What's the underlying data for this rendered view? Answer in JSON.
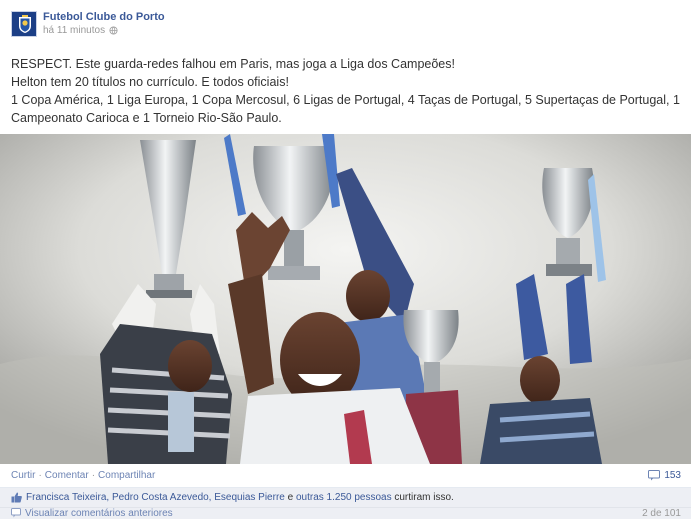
{
  "post": {
    "page_name": "Futebol Clube do Porto",
    "time": "há 11 minutos",
    "text_lines": [
      "RESPECT. Este guarda-redes falhou em Paris, mas joga a Liga dos Campeões!",
      "Helton tem 20 títulos no currículo. E todos oficiais!",
      "1 Copa América, 1 Liga Europa, 1 Copa Mercosul, 6 Ligas de Portugal, 4 Taças de Portugal, 5 Supertaças de Portugal, 1 Campeonato Carioca e 1 Torneio Rio-São Paulo."
    ]
  },
  "actions": {
    "like": "Curtir",
    "comment": "Comentar",
    "share": "Compartilhar",
    "separator": "·",
    "comment_count": "153"
  },
  "likes": {
    "names": "Francisca Teixeira, Pedro Costa Azevedo, Esequias Pierre",
    "connector": " e ",
    "others": "outras 1.250 pessoas",
    "suffix": " curtiram isso."
  },
  "comments": {
    "view_previous": "Visualizar comentários anteriores",
    "pager": "2 de 101"
  },
  "colors": {
    "link": "#3b5998",
    "muted_link": "#6d84b4",
    "likes_bg": "#edeff4"
  }
}
